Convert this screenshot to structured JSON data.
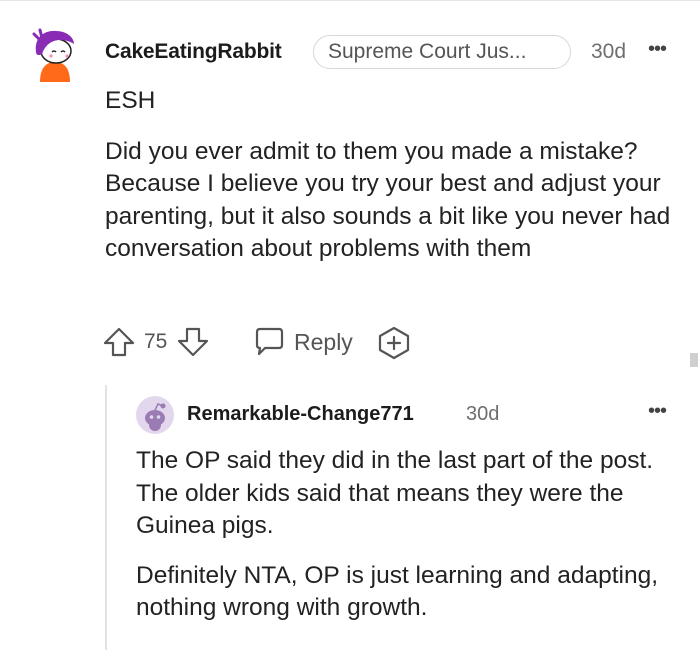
{
  "comment": {
    "username": "CakeEatingRabbit",
    "flair": "Supreme Court Jus...",
    "timestamp": "30d",
    "more": "•••",
    "paragraphs": [
      "ESH",
      "Did you ever admit to them you made a mistake? Because I believe you try your best and adjust your parenting, but it also sounds a bit like you never had conversation about problems with them"
    ],
    "score": "75",
    "reply_label": "Reply",
    "avatar_icon": "snoo-avatar-purple-hair",
    "upvote_icon": "upvote-arrow-icon",
    "downvote_icon": "downvote-arrow-icon",
    "reply_icon": "speech-bubble-icon",
    "award_icon": "award-plus-icon"
  },
  "reply": {
    "username": "Remarkable-Change771",
    "timestamp": "30d",
    "more": "•••",
    "paragraphs": [
      "The OP said they did in the last part of the post. The older kids said that means they were the Guinea pigs.",
      "Definitely NTA, OP is just learning and adapting, nothing wrong with growth."
    ],
    "avatar_icon": "default-snoo-avatar"
  },
  "colors": {
    "text": "#1c1c1c",
    "meta": "#6e6e6e",
    "border": "#d7d7d7",
    "avatar_purple": "#8a2bb5",
    "avatar_orange": "#ff6a1a",
    "reply_avatar_bg": "#e3d7ee"
  }
}
